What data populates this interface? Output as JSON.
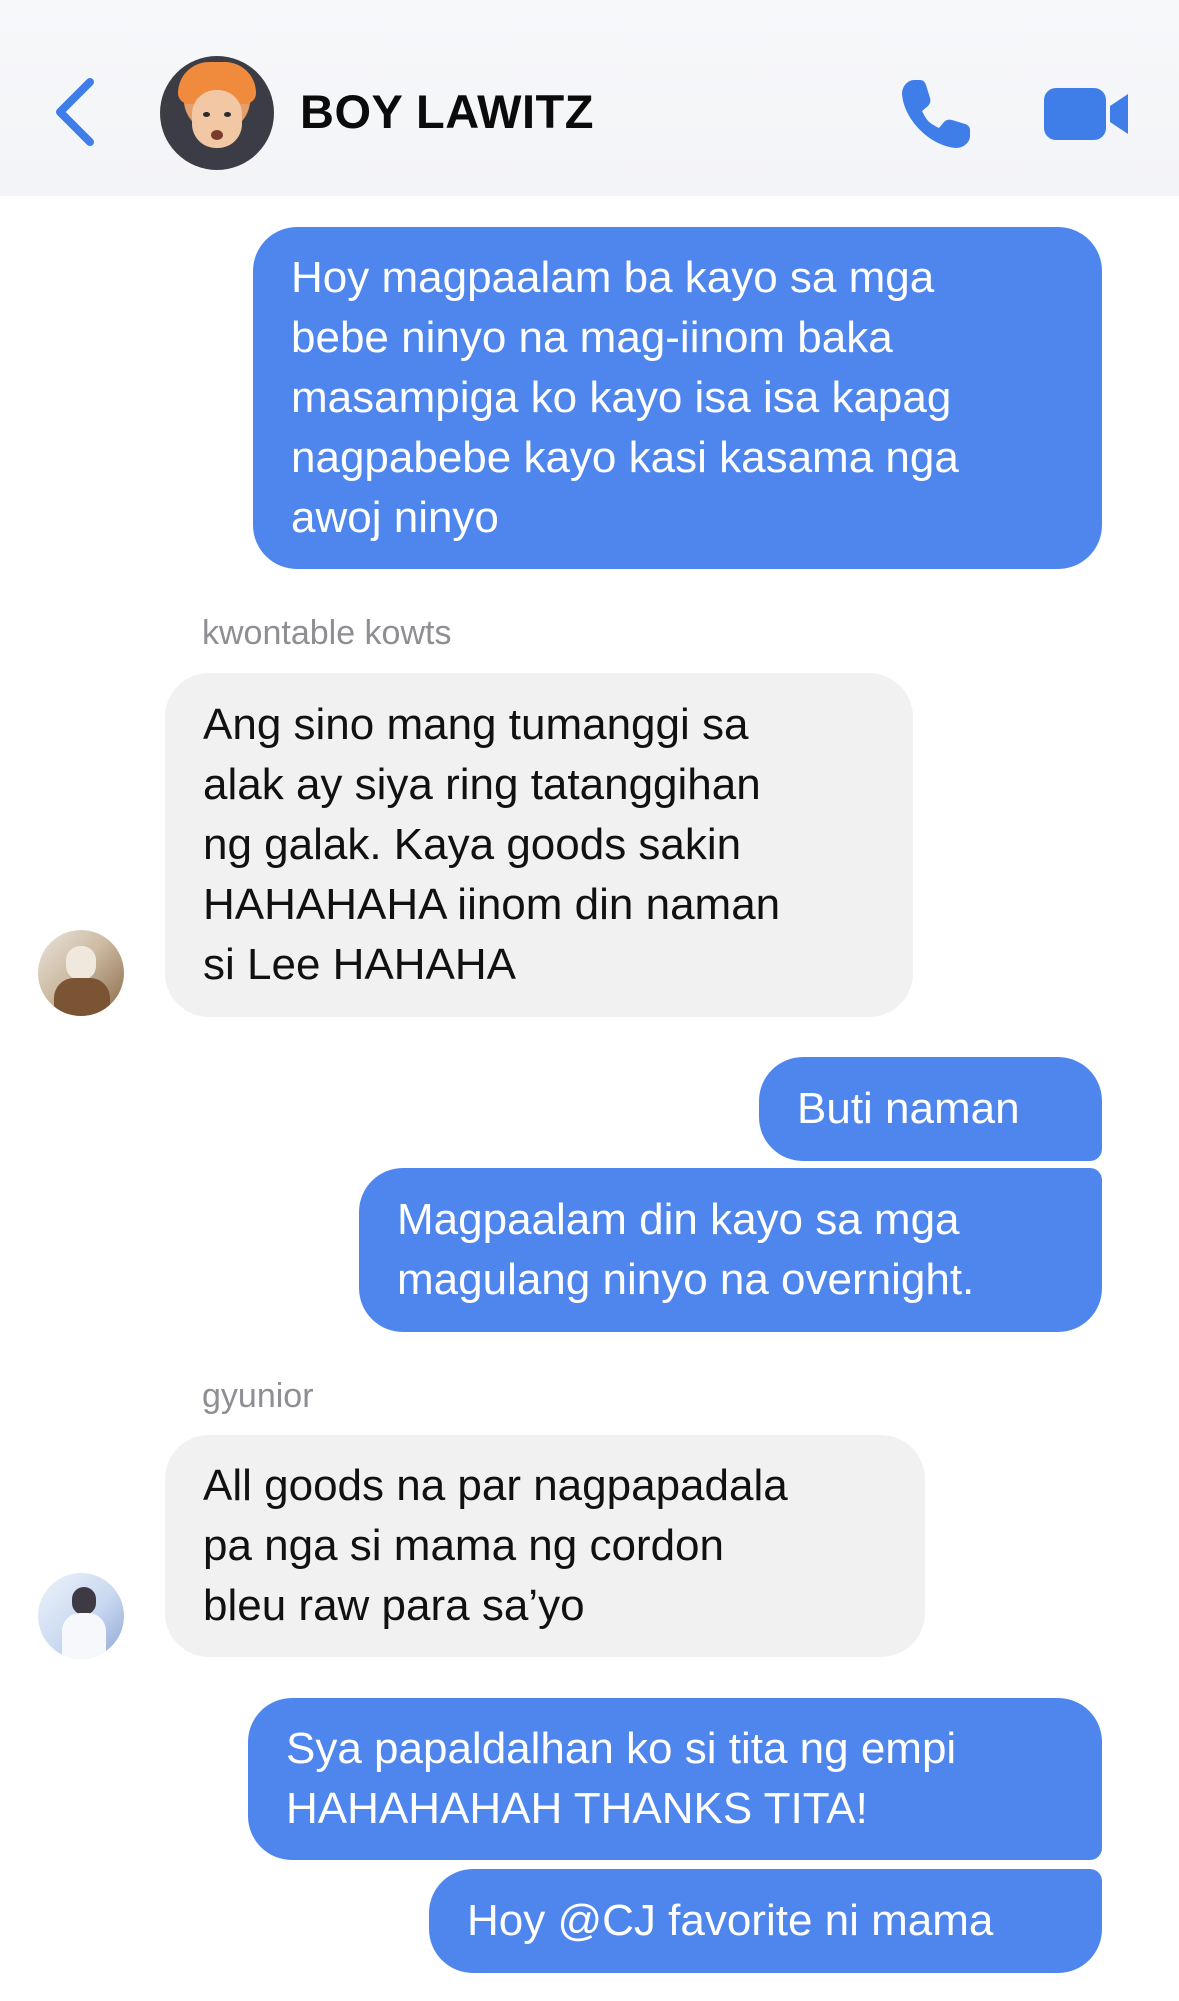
{
  "header": {
    "title": "BOY LAWITZ",
    "back_icon": "chevron-left-icon",
    "call_icon": "phone-icon",
    "video_icon": "video-camera-icon",
    "accent_color": "#3f7ee8"
  },
  "messages": [
    {
      "side": "sent",
      "text": "Hoy magpaalam ba kayo sa mga\nbebe ninyo na mag-iinom baka\nmasampiga ko kayo isa isa kapag\nnagpabebe kayo kasi kasama nga\nawoj ninyo"
    },
    {
      "side": "received",
      "sender": "kwontable kowts",
      "text": "Ang sino mang tumanggi sa\nalak ay siya ring tatanggihan\nng galak. Kaya goods sakin\nHAHAHAHA iinom din naman\nsi Lee HAHAHA"
    },
    {
      "side": "sent",
      "text": "Buti naman"
    },
    {
      "side": "sent",
      "text": "Magpaalam din kayo sa mga\nmagulang ninyo na overnight."
    },
    {
      "side": "received",
      "sender": "gyunior",
      "text": "All goods na par nagpapadala\npa nga si mama ng cordon\nbleu raw para sa’yo"
    },
    {
      "side": "sent",
      "text": "Sya papaldalhan ko si tita ng empi\nHAHAHAHAH THANKS TITA!"
    },
    {
      "side": "sent",
      "text": "Hoy @CJ favorite ni mama"
    }
  ],
  "colors": {
    "sent_bubble": "#4f86ee",
    "received_bubble": "#f1f1f2",
    "sender_label": "#8e8e93"
  }
}
